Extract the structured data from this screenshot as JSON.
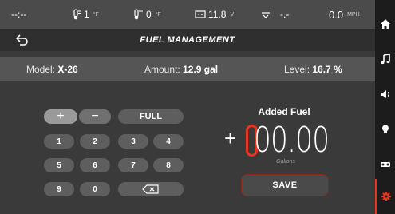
{
  "status": {
    "time": "--:--",
    "temp1": {
      "value": "1",
      "unit": "°F"
    },
    "temp2": {
      "value": "0",
      "unit": "°F"
    },
    "battery": {
      "value": "11.8",
      "unit": "V"
    },
    "ac": {
      "value": "-.-"
    },
    "speed": {
      "value": "0.0",
      "unit": "MPH"
    }
  },
  "title": "FUEL MANAGEMENT",
  "info": {
    "model_label": "Model:",
    "model_value": "X-26",
    "amount_label": "Amount:",
    "amount_value": "12.9 gal",
    "level_label": "Level:",
    "level_value": "16.7 %"
  },
  "keypad": {
    "plus": "+",
    "minus": "−",
    "full": "FULL",
    "keys": [
      "1",
      "2",
      "3",
      "4",
      "5",
      "6",
      "7",
      "8",
      "9",
      "0"
    ]
  },
  "added_fuel": {
    "label": "Added Fuel",
    "sign": "+",
    "value": "00.00",
    "unit": "Gallons",
    "save": "SAVE"
  },
  "nav": [
    "home",
    "music",
    "volume",
    "light",
    "vehicle",
    "settings"
  ],
  "colors": {
    "accent": "#e8341e"
  }
}
